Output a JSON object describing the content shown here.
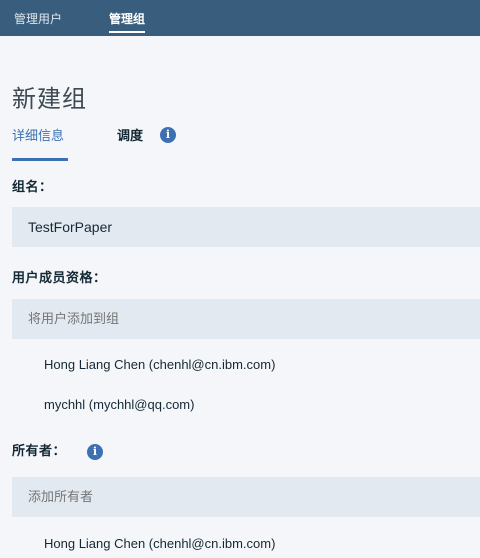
{
  "topnav": {
    "items": [
      {
        "label": "管理用户"
      },
      {
        "label": "管理组"
      }
    ]
  },
  "page": {
    "title": "新建组"
  },
  "tabs": [
    {
      "label": "详细信息"
    },
    {
      "label": "调度"
    }
  ],
  "icons": {
    "info": "i"
  },
  "form": {
    "group_name": {
      "label": "组名：",
      "value": "TestForPaper"
    },
    "membership": {
      "label": "用户成员资格：",
      "placeholder": "将用户添加到组",
      "members": [
        "Hong Liang Chen (chenhl@cn.ibm.com)",
        "mychhl (mychhl@qq.com)"
      ]
    },
    "owners": {
      "label": "所有者：",
      "placeholder": "添加所有者",
      "members": [
        "Hong Liang Chen (chenhl@cn.ibm.com)"
      ]
    }
  },
  "colors": {
    "topbar": "#395d7c",
    "accent": "#3d70b2",
    "field_bg": "#e2e9f1"
  }
}
